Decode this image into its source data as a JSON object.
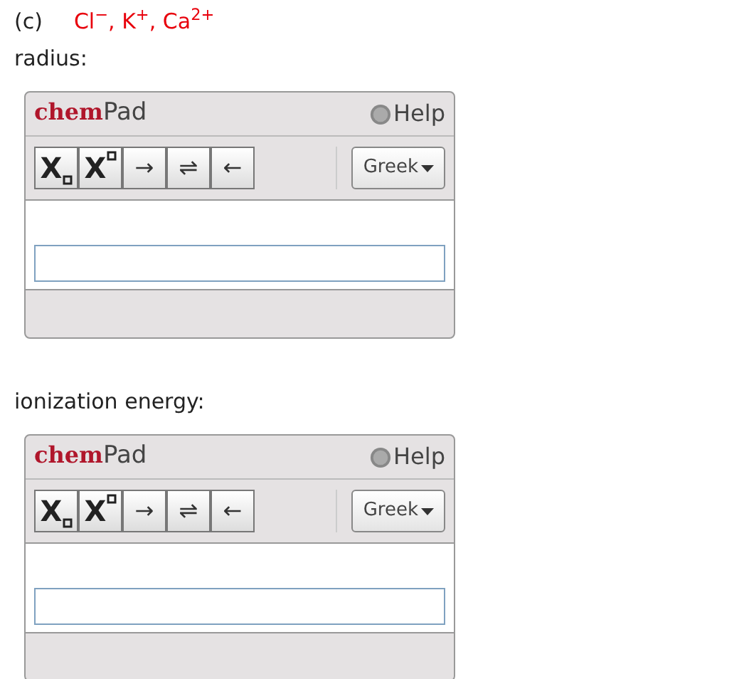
{
  "question": {
    "label": "(c)",
    "species": "Cl$^{−}$, K$^{+}$, Ca$^{2+}$"
  },
  "parts": [
    {
      "label": "radius:",
      "editor": {
        "brand_bold": "chem",
        "brand": "Pad",
        "help": "Help",
        "tools": [
          {
            "kind": "subscript",
            "text": "X"
          },
          {
            "kind": "superscript",
            "text": "X"
          },
          {
            "kind": "symbol",
            "text": "→"
          },
          {
            "kind": "symbol",
            "text": "⇌"
          },
          {
            "kind": "symbol",
            "text": "←"
          }
        ],
        "menu": "Greek"
      }
    },
    {
      "label": "ionization energy:",
      "editor": {
        "brand_bold": "chem",
        "brand": "Pad",
        "help": "Help",
        "tools": [
          {
            "kind": "subscript",
            "text": "X"
          },
          {
            "kind": "superscript",
            "text": "X"
          },
          {
            "kind": "symbol",
            "text": "→"
          },
          {
            "kind": "symbol",
            "text": "⇌"
          },
          {
            "kind": "symbol",
            "text": "←"
          }
        ],
        "menu": "Greek"
      }
    }
  ]
}
